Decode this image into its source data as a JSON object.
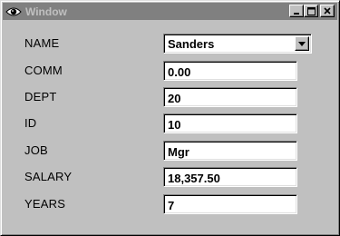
{
  "window": {
    "title": "Window",
    "title_color": "#c0c0c0",
    "titlebar_color": "#808080",
    "app_icon": "eye-icon",
    "controls": [
      "minimize-icon",
      "maximize-icon",
      "close-icon"
    ]
  },
  "form": {
    "name": {
      "label": "NAME",
      "value": "Sanders",
      "dropdown_icon": "chevron-down-icon"
    },
    "comm": {
      "label": "COMM",
      "value": "0.00"
    },
    "dept": {
      "label": "DEPT",
      "value": "20"
    },
    "id": {
      "label": "ID",
      "value": "10"
    },
    "job": {
      "label": "JOB",
      "value": "Mgr"
    },
    "salary": {
      "label": "SALARY",
      "value": "18,357.50"
    },
    "years": {
      "label": "YEARS",
      "value": "7"
    }
  }
}
